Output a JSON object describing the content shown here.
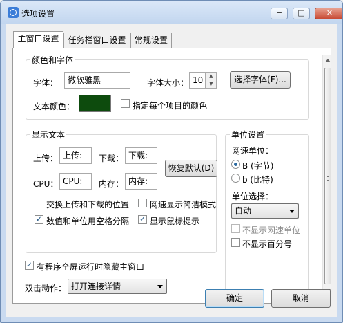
{
  "window": {
    "title": "选项设置",
    "minimize": "−",
    "maximize": "□",
    "close": "✕"
  },
  "tabs": [
    "主窗口设置",
    "任务栏窗口设置",
    "常规设置"
  ],
  "colors_fonts": {
    "legend": "颜色和字体",
    "font_label": "字体：",
    "font_value": "微软雅黑",
    "font_size_label": "字体大小：",
    "font_size_value": "10",
    "select_font": "选择字体(F)...",
    "text_color_label": "文本颜色：",
    "text_color": "#0d4b0d",
    "specify_each_color": "指定每个项目的颜色"
  },
  "display_text": {
    "legend": "显示文本",
    "upload_label": "上传：",
    "upload_value": "上传:",
    "download_label": "下载：",
    "download_value": "下载:",
    "cpu_label": "CPU：",
    "cpu_value": "CPU:",
    "memory_label": "内存：",
    "memory_value": "内存:",
    "restore_default": "恢复默认(D)",
    "swap_position": "交换上传和下载的位置",
    "speed_simple_mode": "网速显示简洁模式",
    "space_between_value_unit": "数值和单位用空格分隔",
    "show_mouse_tip": "显示鼠标提示"
  },
  "unit_settings": {
    "legend": "单位设置",
    "speed_unit_label": "网速单位：",
    "unit_byte": "B (字节)",
    "unit_bit": "b (比特)",
    "unit_choice_label": "单位选择：",
    "unit_choice_value": "自动",
    "hide_speed_unit": "不显示网速单位",
    "hide_percent": "不显示百分号"
  },
  "fullscreen_hide": "有程序全屏运行时隐藏主窗口",
  "double_click": {
    "label": "双击动作：",
    "value": "打开连接详情"
  },
  "buttons": {
    "ok": "确定",
    "cancel": "取消"
  }
}
